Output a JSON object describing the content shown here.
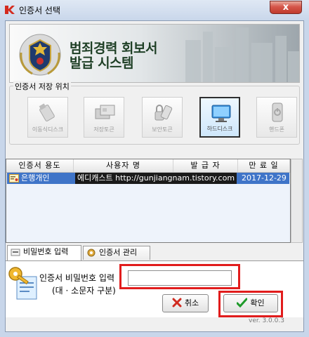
{
  "window": {
    "title": "인증서 선택",
    "close_label": "x"
  },
  "banner": {
    "line1": "범죄경력 회보서",
    "line2": "발급 시스템",
    "emblem_text": "KOREAN NATIONAL POLICE AGENCY"
  },
  "storage": {
    "group_label": "인증서 저장 위치",
    "devices": [
      {
        "label": "이동식디스크",
        "icon": "usb-drive-icon",
        "selected": false
      },
      {
        "label": "저장토큰",
        "icon": "token-card-icon",
        "selected": false
      },
      {
        "label": "보안토큰",
        "icon": "security-token-icon",
        "selected": false
      },
      {
        "label": "하드디스크",
        "icon": "monitor-icon",
        "selected": true
      },
      {
        "label": "핸드폰",
        "icon": "phone-icon",
        "selected": false
      }
    ]
  },
  "cert_table": {
    "columns": [
      "인증서 용도",
      "사용자 명",
      "발 급 자",
      "만 료 일"
    ],
    "rows": [
      {
        "usage": "은행개인",
        "user": "",
        "issuer": "",
        "expiry": "2017-12-29",
        "selected": true
      }
    ],
    "overlay_text": "에디캐스트 http://gunjiangnam.tistory.com"
  },
  "tabs": [
    {
      "label": "비밀번호 입력",
      "icon": "password-tab-icon",
      "active": true
    },
    {
      "label": "인증서 관리",
      "icon": "cert-manage-tab-icon",
      "active": false
    }
  ],
  "password": {
    "label": "인증서 비밀번호 입력",
    "note": "(대 · 소문자 구분)",
    "value": "",
    "placeholder": ""
  },
  "buttons": {
    "cancel": "취소",
    "ok": "확인"
  },
  "version": "ver. 3.0.0.3",
  "colors": {
    "highlight_red": "#e11c1c",
    "selection_blue": "#3f74c8",
    "close_red": "#c03a2c"
  }
}
